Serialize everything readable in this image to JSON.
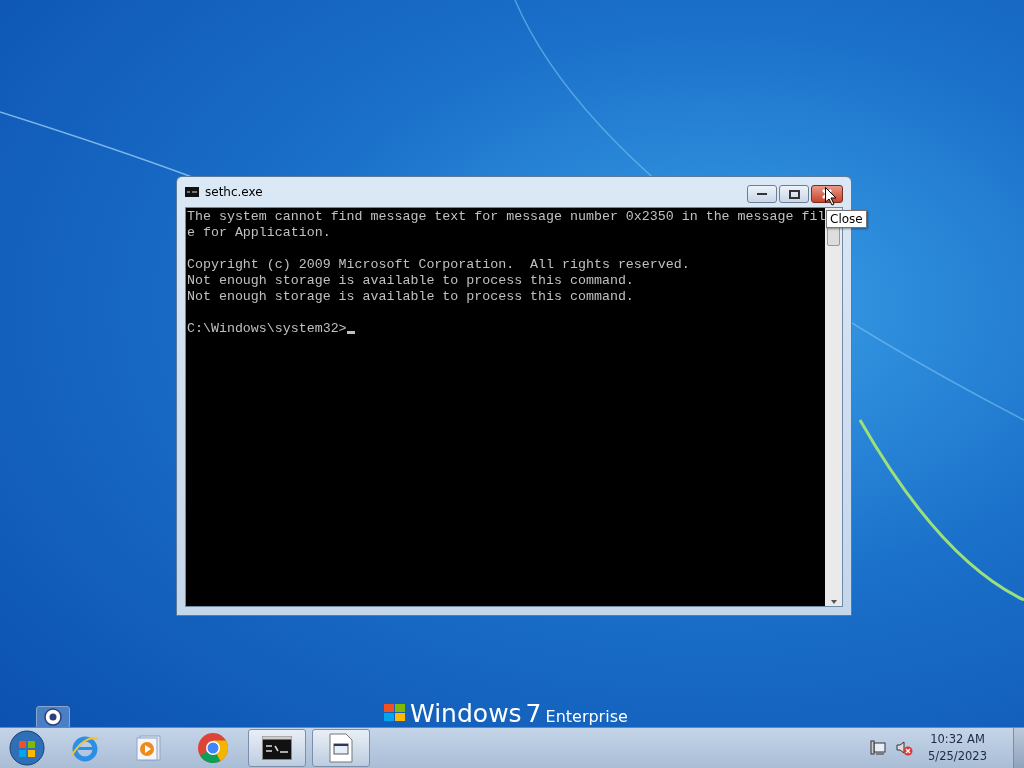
{
  "window": {
    "title": "sethc.exe",
    "tooltip": "Close",
    "console": {
      "blocks": [
        [
          "The system cannot find message text for message number 0x2350 in the message fil",
          "e for Application."
        ],
        [
          "Copyright (c) 2009 Microsoft Corporation.  All rights reserved.",
          "Not enough storage is available to process this command.",
          "Not enough storage is available to process this command."
        ],
        [
          "C:\\Windows\\system32>"
        ]
      ],
      "cursor": true
    }
  },
  "branding": {
    "name": "Windows",
    "version": "7",
    "edition": "Enterprise"
  },
  "taskbar": {
    "items": [
      {
        "kind": "ie",
        "running": false
      },
      {
        "kind": "media",
        "running": false
      },
      {
        "kind": "chrome",
        "running": false
      },
      {
        "kind": "console",
        "running": true
      },
      {
        "kind": "file",
        "running": true
      }
    ],
    "tray": {
      "time": "10:32 AM",
      "date": "5/25/2023"
    }
  }
}
